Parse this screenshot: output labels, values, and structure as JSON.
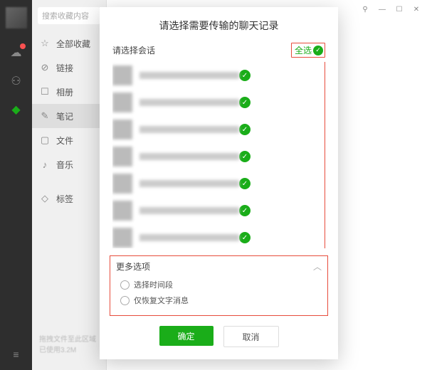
{
  "sidebar": {
    "search_placeholder": "搜索收藏内容",
    "items": [
      {
        "icon": "star",
        "label": "全部收藏"
      },
      {
        "icon": "link",
        "label": "链接"
      },
      {
        "icon": "photo",
        "label": "相册"
      },
      {
        "icon": "note",
        "label": "笔记"
      },
      {
        "icon": "file",
        "label": "文件"
      },
      {
        "icon": "music",
        "label": "音乐"
      }
    ],
    "tag_label": "标签",
    "footer1": "拖拽文件至此区域",
    "footer2": "已使用3.2M"
  },
  "modal": {
    "title": "请选择需要传输的聊天记录",
    "list_header": "请选择会话",
    "select_all": "全选",
    "conversations": [
      {
        "selected": true
      },
      {
        "selected": true
      },
      {
        "selected": true
      },
      {
        "selected": true
      },
      {
        "selected": true
      },
      {
        "selected": true
      },
      {
        "selected": true
      }
    ],
    "more_section": "更多选项",
    "opt_time": "选择时间段",
    "opt_text": "仅恢复文字消息",
    "ok": "确定",
    "cancel": "取消"
  },
  "window": {
    "pin": "⚲",
    "min": "—",
    "max": "☐",
    "close": "✕"
  }
}
